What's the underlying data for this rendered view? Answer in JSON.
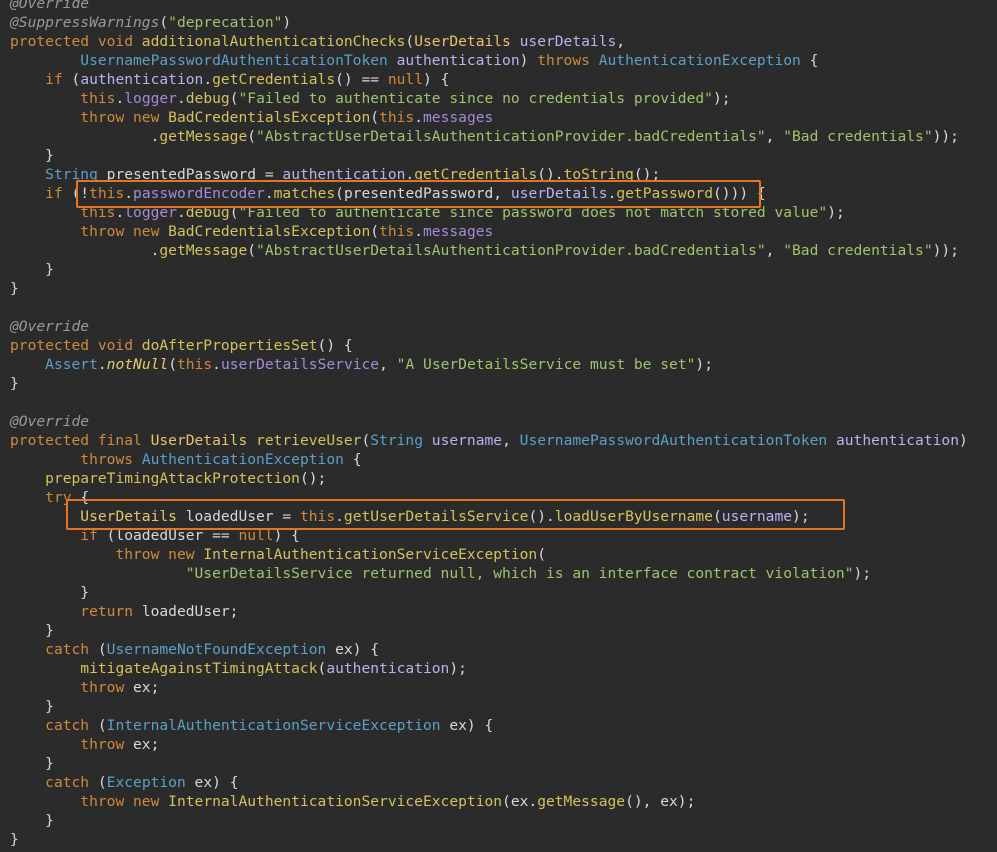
{
  "colors": {
    "background": "#2b2b2b",
    "keyword": "#d08a3a",
    "type": "#5aa0c8",
    "method": "#d4c25a",
    "string": "#9fc46a",
    "annotation": "#9a9a9a",
    "field": "#a68ad8",
    "highlight_box": "#e5761f"
  },
  "lines": [
    [
      [
        "ann",
        "@Override"
      ]
    ],
    [
      [
        "ann",
        "@SuppressWarnings"
      ],
      [
        "pl",
        "("
      ],
      [
        "str",
        "\"deprecation\""
      ],
      [
        "pl",
        ")"
      ]
    ],
    [
      [
        "kw",
        "protected void "
      ],
      [
        "fn",
        "additionalAuthenticationChecks"
      ],
      [
        "pl",
        "("
      ],
      [
        "tyd",
        "UserDetails "
      ],
      [
        "prm",
        "userDetails"
      ],
      [
        "pl",
        ","
      ]
    ],
    [
      [
        "pl",
        "        "
      ],
      [
        "ty",
        "UsernamePasswordAuthenticationToken "
      ],
      [
        "prm",
        "authentication"
      ],
      [
        "pl",
        ") "
      ],
      [
        "kw",
        "throws "
      ],
      [
        "ty",
        "AuthenticationException"
      ],
      [
        "pl",
        " {"
      ]
    ],
    [
      [
        "pl",
        "    "
      ],
      [
        "kw",
        "if "
      ],
      [
        "pl",
        "("
      ],
      [
        "prm",
        "authentication"
      ],
      [
        "pl",
        "."
      ],
      [
        "fn",
        "getCredentials"
      ],
      [
        "pl",
        "() == "
      ],
      [
        "kw",
        "null"
      ],
      [
        "pl",
        ") {"
      ]
    ],
    [
      [
        "pl",
        "        "
      ],
      [
        "kw",
        "this"
      ],
      [
        "pl",
        "."
      ],
      [
        "fld",
        "logger"
      ],
      [
        "pl",
        "."
      ],
      [
        "fn",
        "debug"
      ],
      [
        "pl",
        "("
      ],
      [
        "str",
        "\"Failed to authenticate since no credentials provided\""
      ],
      [
        "pl",
        ");"
      ]
    ],
    [
      [
        "pl",
        "        "
      ],
      [
        "kw",
        "throw new "
      ],
      [
        "fn",
        "BadCredentialsException"
      ],
      [
        "pl",
        "("
      ],
      [
        "kw",
        "this"
      ],
      [
        "pl",
        "."
      ],
      [
        "fld",
        "messages"
      ]
    ],
    [
      [
        "pl",
        "                ."
      ],
      [
        "fn",
        "getMessage"
      ],
      [
        "pl",
        "("
      ],
      [
        "str",
        "\"AbstractUserDetailsAuthenticationProvider.badCredentials\""
      ],
      [
        "pl",
        ", "
      ],
      [
        "str",
        "\"Bad credentials\""
      ],
      [
        "pl",
        "));"
      ]
    ],
    [
      [
        "pl",
        "    }"
      ]
    ],
    [
      [
        "pl",
        "    "
      ],
      [
        "ty",
        "String "
      ],
      [
        "pl",
        "presentedPassword = "
      ],
      [
        "prm",
        "authentication"
      ],
      [
        "pl",
        "."
      ],
      [
        "fn",
        "getCredentials"
      ],
      [
        "pl",
        "()."
      ],
      [
        "fn",
        "toString"
      ],
      [
        "pl",
        "();"
      ]
    ],
    [
      [
        "pl",
        "    "
      ],
      [
        "kw",
        "if "
      ],
      [
        "pl",
        "(!"
      ],
      [
        "kw",
        "this"
      ],
      [
        "pl",
        "."
      ],
      [
        "fld",
        "passwordEncoder"
      ],
      [
        "pl",
        "."
      ],
      [
        "fn",
        "matches"
      ],
      [
        "pl",
        "(presentedPassword, "
      ],
      [
        "prm",
        "userDetails"
      ],
      [
        "pl",
        "."
      ],
      [
        "fn",
        "getPassword"
      ],
      [
        "pl",
        "())) {"
      ]
    ],
    [
      [
        "pl",
        "        "
      ],
      [
        "kw",
        "this"
      ],
      [
        "pl",
        "."
      ],
      [
        "fld",
        "logger"
      ],
      [
        "pl",
        "."
      ],
      [
        "fn",
        "debug"
      ],
      [
        "pl",
        "("
      ],
      [
        "str",
        "\"Failed to authenticate since password does not match stored value\""
      ],
      [
        "pl",
        ");"
      ]
    ],
    [
      [
        "pl",
        "        "
      ],
      [
        "kw",
        "throw new "
      ],
      [
        "fn",
        "BadCredentialsException"
      ],
      [
        "pl",
        "("
      ],
      [
        "kw",
        "this"
      ],
      [
        "pl",
        "."
      ],
      [
        "fld",
        "messages"
      ]
    ],
    [
      [
        "pl",
        "                ."
      ],
      [
        "fn",
        "getMessage"
      ],
      [
        "pl",
        "("
      ],
      [
        "str",
        "\"AbstractUserDetailsAuthenticationProvider.badCredentials\""
      ],
      [
        "pl",
        ", "
      ],
      [
        "str",
        "\"Bad credentials\""
      ],
      [
        "pl",
        "));"
      ]
    ],
    [
      [
        "pl",
        "    }"
      ]
    ],
    [
      [
        "pl",
        "}"
      ]
    ],
    [],
    [
      [
        "ann",
        "@Override"
      ]
    ],
    [
      [
        "kw",
        "protected void "
      ],
      [
        "fn",
        "doAfterPropertiesSet"
      ],
      [
        "pl",
        "() {"
      ]
    ],
    [
      [
        "pl",
        "    "
      ],
      [
        "ty",
        "Assert"
      ],
      [
        "pl",
        "."
      ],
      [
        "stat",
        "notNull"
      ],
      [
        "pl",
        "("
      ],
      [
        "kw",
        "this"
      ],
      [
        "pl",
        "."
      ],
      [
        "fld",
        "userDetailsService"
      ],
      [
        "pl",
        ", "
      ],
      [
        "str",
        "\"A UserDetailsService must be set\""
      ],
      [
        "pl",
        ");"
      ]
    ],
    [
      [
        "pl",
        "}"
      ]
    ],
    [],
    [
      [
        "ann",
        "@Override"
      ]
    ],
    [
      [
        "kw",
        "protected final "
      ],
      [
        "tyd",
        "UserDetails "
      ],
      [
        "fn",
        "retrieveUser"
      ],
      [
        "pl",
        "("
      ],
      [
        "ty",
        "String "
      ],
      [
        "prm",
        "username"
      ],
      [
        "pl",
        ", "
      ],
      [
        "ty",
        "UsernamePasswordAuthenticationToken "
      ],
      [
        "prm",
        "authentication"
      ],
      [
        "pl",
        ")"
      ]
    ],
    [
      [
        "pl",
        "        "
      ],
      [
        "kw",
        "throws "
      ],
      [
        "ty",
        "AuthenticationException"
      ],
      [
        "pl",
        " {"
      ]
    ],
    [
      [
        "pl",
        "    "
      ],
      [
        "fn",
        "prepareTimingAttackProtection"
      ],
      [
        "pl",
        "();"
      ]
    ],
    [
      [
        "pl",
        "    "
      ],
      [
        "kw",
        "try "
      ],
      [
        "pl",
        "{"
      ]
    ],
    [
      [
        "pl",
        "        "
      ],
      [
        "tyd",
        "UserDetails "
      ],
      [
        "pl",
        "loadedUser = "
      ],
      [
        "kw",
        "this"
      ],
      [
        "pl",
        "."
      ],
      [
        "fn",
        "getUserDetailsService"
      ],
      [
        "pl",
        "()."
      ],
      [
        "fn",
        "loadUserByUsername"
      ],
      [
        "pl",
        "("
      ],
      [
        "prm",
        "username"
      ],
      [
        "pl",
        ");"
      ]
    ],
    [
      [
        "pl",
        "        "
      ],
      [
        "kw",
        "if "
      ],
      [
        "pl",
        "(loadedUser == "
      ],
      [
        "kw",
        "null"
      ],
      [
        "pl",
        ") {"
      ]
    ],
    [
      [
        "pl",
        "            "
      ],
      [
        "kw",
        "throw new "
      ],
      [
        "fn",
        "InternalAuthenticationServiceException"
      ],
      [
        "pl",
        "("
      ]
    ],
    [
      [
        "pl",
        "                    "
      ],
      [
        "str",
        "\"UserDetailsService returned null, which is an interface contract violation\""
      ],
      [
        "pl",
        ");"
      ]
    ],
    [
      [
        "pl",
        "        }"
      ]
    ],
    [
      [
        "pl",
        "        "
      ],
      [
        "kw",
        "return "
      ],
      [
        "pl",
        "loadedUser;"
      ]
    ],
    [
      [
        "pl",
        "    }"
      ]
    ],
    [
      [
        "pl",
        "    "
      ],
      [
        "kw",
        "catch "
      ],
      [
        "pl",
        "("
      ],
      [
        "ty",
        "UsernameNotFoundException "
      ],
      [
        "pl",
        "ex) {"
      ]
    ],
    [
      [
        "pl",
        "        "
      ],
      [
        "fn",
        "mitigateAgainstTimingAttack"
      ],
      [
        "pl",
        "("
      ],
      [
        "prm",
        "authentication"
      ],
      [
        "pl",
        ");"
      ]
    ],
    [
      [
        "pl",
        "        "
      ],
      [
        "kw",
        "throw "
      ],
      [
        "pl",
        "ex;"
      ]
    ],
    [
      [
        "pl",
        "    }"
      ]
    ],
    [
      [
        "pl",
        "    "
      ],
      [
        "kw",
        "catch "
      ],
      [
        "pl",
        "("
      ],
      [
        "ty",
        "InternalAuthenticationServiceException "
      ],
      [
        "pl",
        "ex) {"
      ]
    ],
    [
      [
        "pl",
        "        "
      ],
      [
        "kw",
        "throw "
      ],
      [
        "pl",
        "ex;"
      ]
    ],
    [
      [
        "pl",
        "    }"
      ]
    ],
    [
      [
        "pl",
        "    "
      ],
      [
        "kw",
        "catch "
      ],
      [
        "pl",
        "("
      ],
      [
        "ty",
        "Exception "
      ],
      [
        "pl",
        "ex) {"
      ]
    ],
    [
      [
        "pl",
        "        "
      ],
      [
        "kw",
        "throw new "
      ],
      [
        "fn",
        "InternalAuthenticationServiceException"
      ],
      [
        "pl",
        "(ex."
      ],
      [
        "fn",
        "getMessage"
      ],
      [
        "pl",
        "(), ex);"
      ]
    ],
    [
      [
        "pl",
        "    }"
      ]
    ],
    [
      [
        "pl",
        "}"
      ]
    ]
  ]
}
